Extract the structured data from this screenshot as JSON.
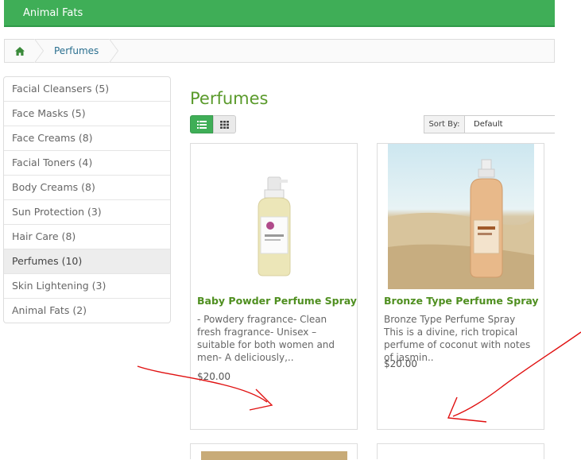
{
  "topbar": {
    "label": "Animal Fats"
  },
  "breadcrumb": {
    "home_icon": "home-icon",
    "current": "Perfumes"
  },
  "sidebar": {
    "items": [
      {
        "label": "Facial Cleansers (5)"
      },
      {
        "label": "Face Masks (5)"
      },
      {
        "label": "Face Creams (8)"
      },
      {
        "label": "Facial Toners (4)"
      },
      {
        "label": "Body Creams (8)"
      },
      {
        "label": "Sun Protection (3)"
      },
      {
        "label": "Hair Care (8)"
      },
      {
        "label": "Perfumes (10)"
      },
      {
        "label": "Skin Lightening (3)"
      },
      {
        "label": "Animal Fats (2)"
      }
    ],
    "active_index": 7
  },
  "main": {
    "title": "Perfumes",
    "view_toggle": {
      "list_icon": "list-icon",
      "grid_icon": "grid-icon",
      "active": "list"
    },
    "sort": {
      "label": "Sort By:",
      "value": "Default"
    },
    "products": [
      {
        "name": "Baby Powder Perfume Spray",
        "description": "- Powdery fragrance- Clean fresh fragrance- Unisex – suitable for both women and men- A deliciously,..",
        "price": "$20.00"
      },
      {
        "name": "Bronze Type Perfume Spray",
        "description": "Bronze Type Perfume Spray This is a divine, rich tropical perfume of coconut with notes of jasmin..",
        "price": "$20.00"
      }
    ]
  },
  "colors": {
    "brand_green": "#3fae57",
    "title_green": "#5a9a2b",
    "product_name_green": "#4f8f20",
    "annotation_red": "#e01010"
  }
}
